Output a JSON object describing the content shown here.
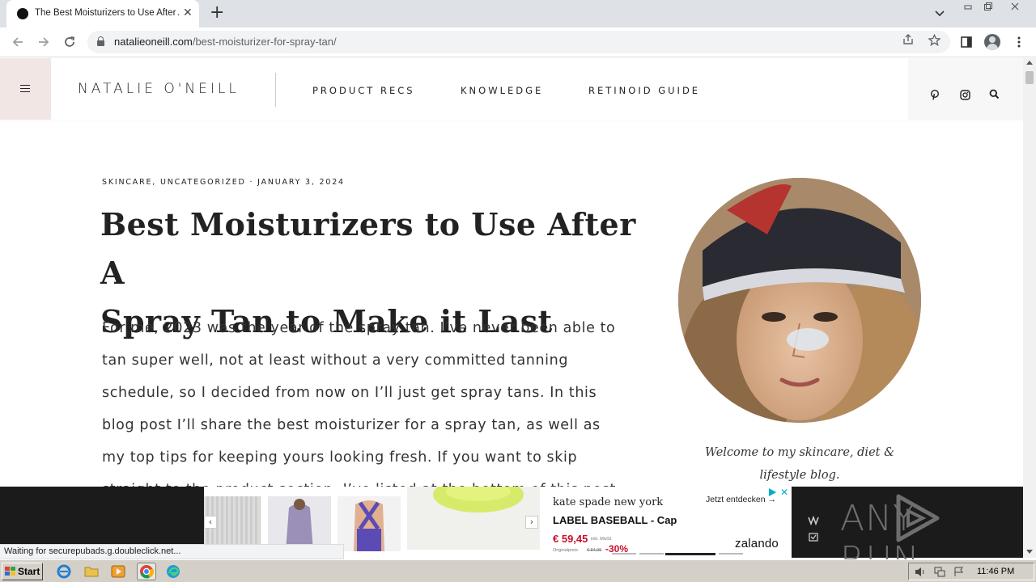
{
  "browser": {
    "tab_title": "The Best Moisturizers to Use After A Spray Tan",
    "tab_close": "✕",
    "new_tab": "+",
    "url_domain": "natalieoneill.com",
    "url_path": "/best-moisturizer-for-spray-tan/",
    "status_text": "Waiting for securepubads.g.doubleclick.net..."
  },
  "site": {
    "logo": "NATALIE O'NEILL",
    "nav": [
      "PRODUCT RECS",
      "KNOWLEDGE",
      "RETINOID GUIDE"
    ]
  },
  "article": {
    "meta": "SKINCARE, UNCATEGORIZED · JANUARY 3, 2024",
    "title_line1": "Best Moisturizers to Use After A",
    "title_line2": "Spray Tan to Make it Last",
    "body_lines": [
      "For me, 2023 was the year of the spray tan. I’ve never been able to",
      "tan super well, not at least without a very committed tanning",
      "schedule, so I decided from now on I’ll just get spray tans. In this",
      "blog post I’ll share the best moisturizer for a spray tan, as well as",
      "my top tips for keeping yours looking fresh. If you want to skip",
      "straight to the product section, I’ve listed at the bottom of this post"
    ]
  },
  "sidebar": {
    "welcome_line1": "Welcome to my skincare, diet &",
    "welcome_line2": "lifestyle blog."
  },
  "ad": {
    "brand": "kate spade new york",
    "product": "LABEL BASEBALL - Cap",
    "price": "€ 59,45",
    "vat_note": "inkl. MwSt.",
    "orig_label": "Originalpreis",
    "orig_price": "€ 84,95",
    "discount": "-30%",
    "cta": "Jetzt entdecken →",
    "advertiser": "zalando",
    "prev_arrow": "‹",
    "next_arrow": "›",
    "close": "✕"
  },
  "overlay": {
    "anyrun_left": "ANY",
    "anyrun_right": "RUN"
  },
  "taskbar": {
    "start_label": "Start",
    "clock": "11:46 PM"
  },
  "colors": {
    "menu_toggle_bg": "#f1e6e4",
    "ad_red": "#c8102e",
    "ad_close": "#00aecd"
  }
}
